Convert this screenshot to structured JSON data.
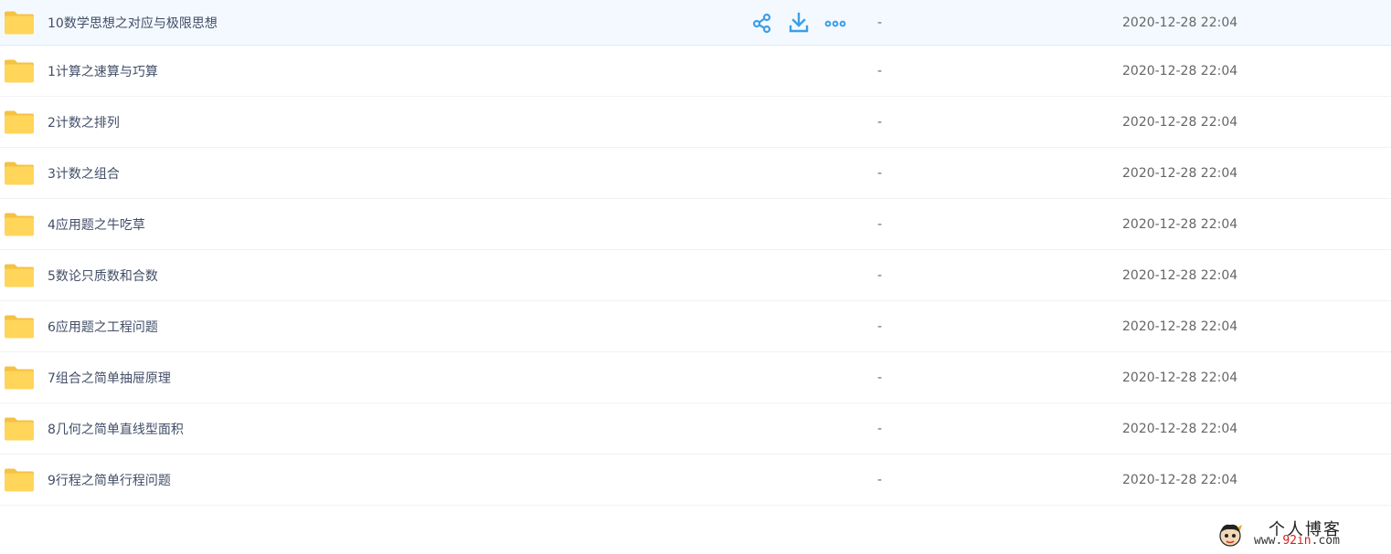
{
  "files": [
    {
      "name": "10数学思想之对应与极限思想",
      "size": "-",
      "modified": "2020-12-28 22:04",
      "hover": true
    },
    {
      "name": "1计算之速算与巧算",
      "size": "-",
      "modified": "2020-12-28 22:04"
    },
    {
      "name": "2计数之排列",
      "size": "-",
      "modified": "2020-12-28 22:04"
    },
    {
      "name": "3计数之组合",
      "size": "-",
      "modified": "2020-12-28 22:04"
    },
    {
      "name": "4应用题之牛吃草",
      "size": "-",
      "modified": "2020-12-28 22:04"
    },
    {
      "name": "5数论只质数和合数",
      "size": "-",
      "modified": "2020-12-28 22:04"
    },
    {
      "name": "6应用题之工程问题",
      "size": "-",
      "modified": "2020-12-28 22:04"
    },
    {
      "name": "7组合之简单抽屉原理",
      "size": "-",
      "modified": "2020-12-28 22:04"
    },
    {
      "name": "8几何之简单直线型面积",
      "size": "-",
      "modified": "2020-12-28 22:04"
    },
    {
      "name": "9行程之简单行程问题",
      "size": "-",
      "modified": "2020-12-28 22:04"
    }
  ],
  "row_actions": {
    "share_icon": "share-icon",
    "download_icon": "download-icon",
    "more_icon": "more-icon"
  },
  "watermark": {
    "title": "个人博客",
    "url_prefix": "www.",
    "url_brand": "92in",
    "url_suffix": ".com"
  },
  "colors": {
    "folder": "#ffd55a",
    "folder_tab": "#f5c242",
    "accent": "#3b9fe6",
    "hover_bg": "#f4f9ff",
    "text": "#424e67",
    "meta_text": "#666666"
  }
}
